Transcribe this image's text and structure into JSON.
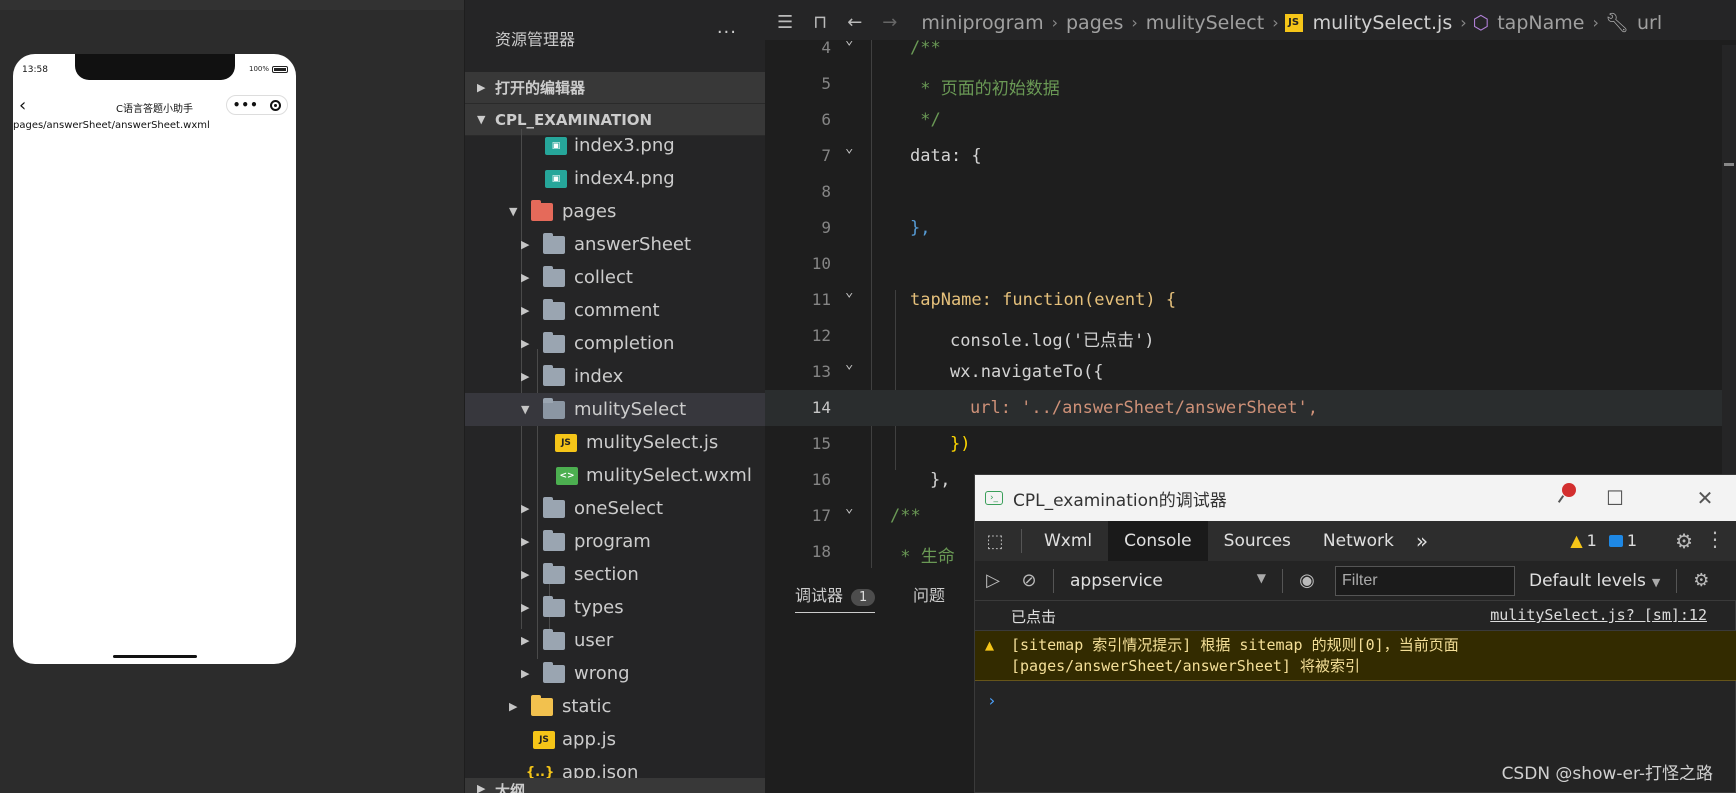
{
  "simulator": {
    "time": "13:58",
    "battery": "100%",
    "nav_back": "‹",
    "nav_title": "C语言答题小助手",
    "capsule_more": "•••",
    "page_path": "pages/answerSheet/answerSheet.wxml"
  },
  "explorer": {
    "title": "资源管理器",
    "more": "···",
    "section_open_editors": "打开的编辑器",
    "section_project": "CPL_EXAMINATION",
    "items": [
      {
        "label": "index3.png"
      },
      {
        "label": "index4.png"
      },
      {
        "label": "pages"
      },
      {
        "label": "answerSheet"
      },
      {
        "label": "collect"
      },
      {
        "label": "comment"
      },
      {
        "label": "completion"
      },
      {
        "label": "index"
      },
      {
        "label": "mulitySelect"
      },
      {
        "label": "mulitySelect.js"
      },
      {
        "label": "mulitySelect.wxml"
      },
      {
        "label": "oneSelect"
      },
      {
        "label": "program"
      },
      {
        "label": "section"
      },
      {
        "label": "types"
      },
      {
        "label": "user"
      },
      {
        "label": "wrong"
      },
      {
        "label": "static"
      },
      {
        "label": "app.js"
      },
      {
        "label": "app.json"
      }
    ],
    "bottom_section": "大纲"
  },
  "breadcrumb": {
    "parts": [
      "miniprogram",
      "pages",
      "mulitySelect",
      "mulitySelect.js",
      "tapName",
      "url"
    ]
  },
  "code": {
    "lines": [
      {
        "n": "4",
        "t": "/**"
      },
      {
        "n": "5",
        "t": " * 页面的初始数据"
      },
      {
        "n": "6",
        "t": " */"
      },
      {
        "n": "7",
        "t": "data: {"
      },
      {
        "n": "8",
        "t": ""
      },
      {
        "n": "9",
        "t": "},"
      },
      {
        "n": "10",
        "t": ""
      },
      {
        "n": "11",
        "t": "tapName: function(event) {"
      },
      {
        "n": "12",
        "t": "console.log('已点击')"
      },
      {
        "n": "13",
        "t": "wx.navigateTo({"
      },
      {
        "n": "14",
        "t": "url: '../answerSheet/answerSheet',"
      },
      {
        "n": "15",
        "t": "})"
      },
      {
        "n": "16",
        "t": "},"
      },
      {
        "n": "17",
        "t": "/**"
      },
      {
        "n": "18",
        "t": " * 生命"
      }
    ]
  },
  "bottom_panel": {
    "tab_debugger": "调试器",
    "debugger_badge": "1",
    "tab_problems": "问题"
  },
  "debugger": {
    "title": "CPL_examination的调试器",
    "tabs": [
      "Wxml",
      "Console",
      "Sources",
      "Network"
    ],
    "active_tab": "Console",
    "more_tabs": "»",
    "warn_count": "1",
    "info_count": "1",
    "context": "appservice",
    "filter_placeholder": "Filter",
    "levels": "Default levels",
    "log_line": "已点击",
    "log_source": "mulitySelect.js? [sm]:12",
    "warn_line1": "[sitemap 索引情况提示] 根据 sitemap 的规则[0]，当前页面",
    "warn_line2": "[pages/answerSheet/answerSheet] 将被索引",
    "prompt": "›"
  },
  "watermark": "CSDN @show-er-打怪之路",
  "colors": {
    "accent": "#4da3ff",
    "warning": "#f5c518",
    "error": "#ef5350"
  }
}
